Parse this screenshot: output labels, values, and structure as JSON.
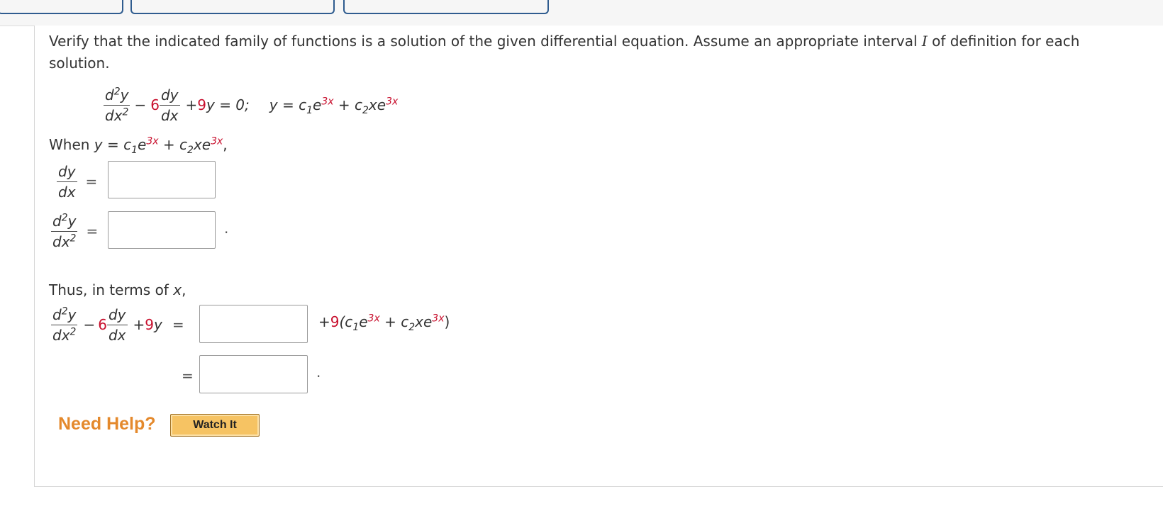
{
  "problem": {
    "intro_text": "Verify that the indicated family of functions is a solution of the given differential equation. Assume an appropriate interval",
    "interval_symbol": "I",
    "intro_text_2": "of definition for each",
    "intro_text_3": "solution."
  },
  "equation": {
    "d2y": "d",
    "dx2": "dx",
    "coef_dy": "6",
    "dy_num": "dy",
    "dy_den": "dx",
    "plus_9y_a": "+ ",
    "coef_9": "9",
    "y_eq_zero": "y = 0;",
    "solution_y": "y = c",
    "solution_sub1": "1",
    "solution_e": "e",
    "exp_3x": "3x",
    "solution_plus": " + c",
    "solution_sub2": "2",
    "solution_xe": "xe"
  },
  "when": {
    "label": "When ",
    "y": "y = c",
    "e": "e",
    "exp": "3x",
    "plus": " + c",
    "xe": "xe",
    "comma": ","
  },
  "derivs": {
    "dy": "dy",
    "dx": "dx",
    "eq": "=",
    "period": "."
  },
  "thus": {
    "label": "Thus, in terms of ",
    "x": "x",
    "comma": ",",
    "plus9": "+ ",
    "nine": "9",
    "paren_open": "(c",
    "paren_e": "e",
    "paren_plus": " + c",
    "paren_xe": "xe",
    "paren_close": ")",
    "period": "."
  },
  "help": {
    "need_help": "Need Help?",
    "watch_it": "Watch It"
  },
  "answers": {
    "dy_dx": "",
    "d2y_dx2": "",
    "expr_1": "",
    "expr_2": ""
  }
}
